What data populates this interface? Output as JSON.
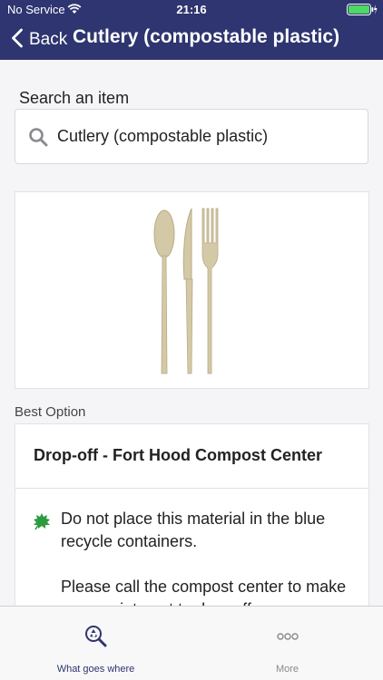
{
  "status_bar": {
    "carrier": "No Service",
    "time": "21:16"
  },
  "nav": {
    "back_label": "Back",
    "title": "Cutlery (compostable plastic)"
  },
  "search": {
    "label": "Search an item",
    "value": "Cutlery (compostable plastic)"
  },
  "item_image": {
    "icon": "cutlery-image"
  },
  "best_option": {
    "section_label": "Best Option",
    "title": "Drop-off - Fort Hood Compost Center",
    "icon": "leaf-icon",
    "instructions": [
      "Do not place this material in the blue recycle containers.",
      "Please call the compost center to make an appointment to drop off."
    ]
  },
  "tabs": [
    {
      "label": "What goes where",
      "icon": "recycle-search-icon",
      "active": true
    },
    {
      "label": "More",
      "icon": "more-icon",
      "active": false
    }
  ],
  "colors": {
    "header_bg": "#2e3570",
    "leaf_green": "#2e9a3e",
    "active_tab": "#2e3570",
    "inactive_tab": "#8a8a8e"
  }
}
